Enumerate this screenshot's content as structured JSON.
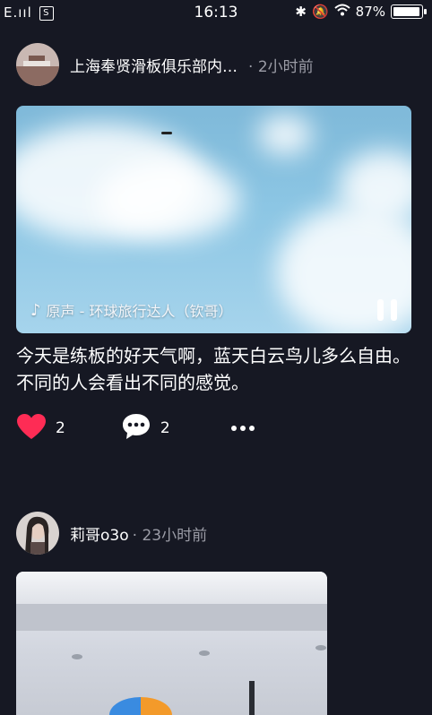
{
  "status_bar": {
    "signal": "E.ııl",
    "time": "16:13",
    "battery": "87%"
  },
  "posts": [
    {
      "author": "上海奉贤滑板俱乐部内…",
      "time_ago": "2小时前",
      "music": "原声 - 环球旅行达人（钦哥）",
      "caption": "今天是练板的好天气啊，蓝天白云鸟儿多么自由。不同的人会看出不同的感觉。",
      "likes": "2",
      "comments": "2"
    },
    {
      "author": "莉哥o3o",
      "time_ago": "23小时前"
    }
  ]
}
